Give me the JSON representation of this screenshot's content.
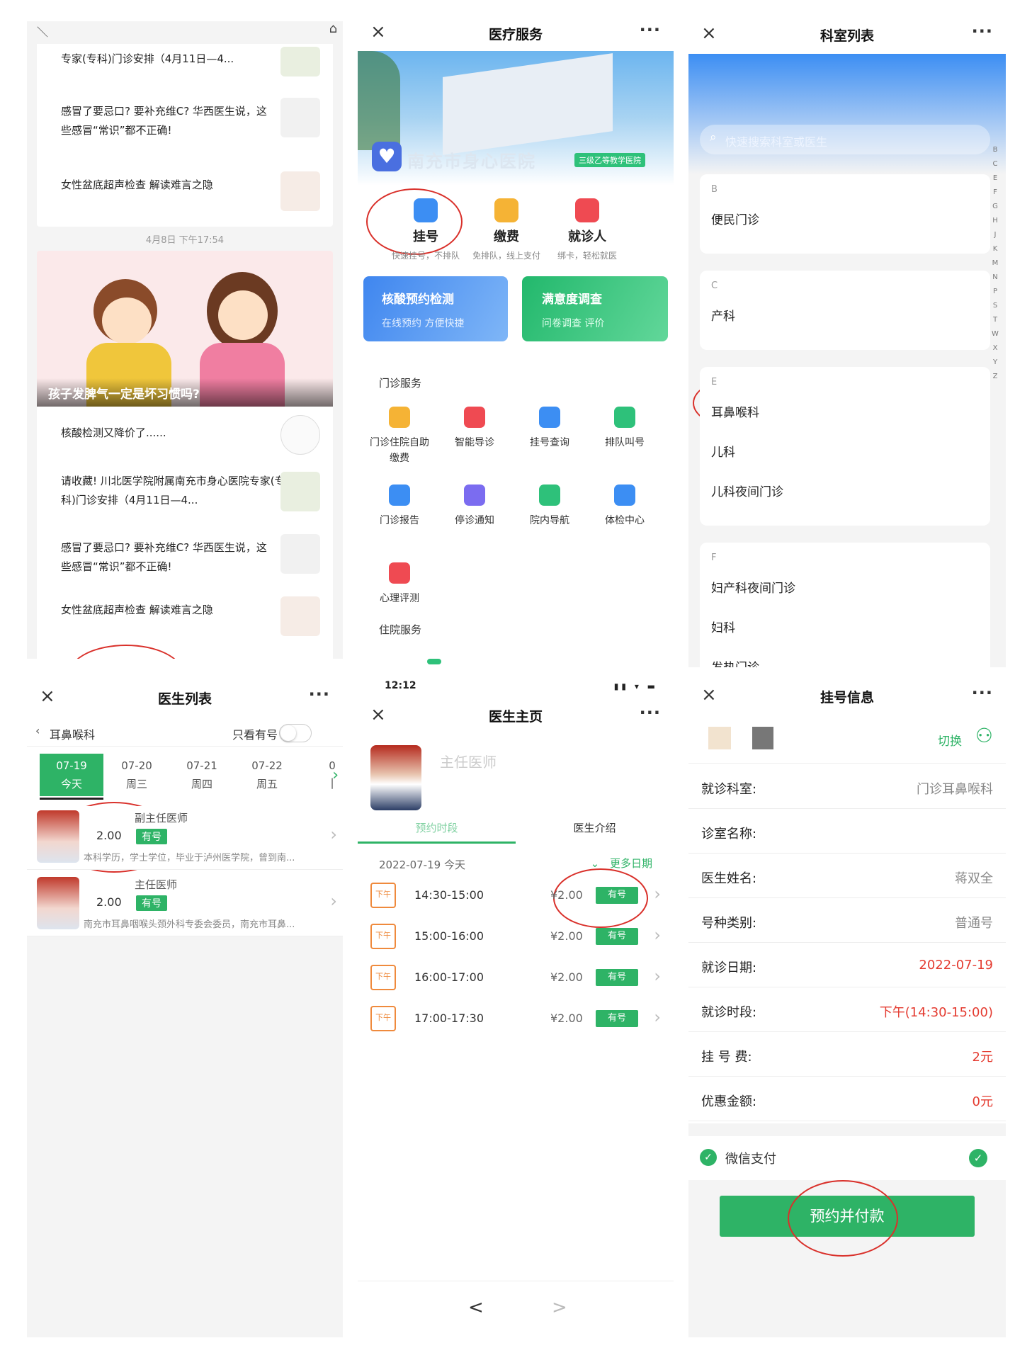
{
  "panel1": {
    "news_top": [
      {
        "title": "专家(专科)门诊安排（4月11日—4..."
      },
      {
        "title": "感冒了要忌口? 要补充维C? 华西医生说，这些感冒“常识”都不正确!"
      },
      {
        "title": "女性盆底超声检查 解读难言之隐"
      }
    ],
    "timestamp": "4月8日 下午17:54",
    "feature_caption": "孩子发脾气一定是坏习惯吗?",
    "news_bottom": [
      {
        "title": "核酸检测又降价了......"
      },
      {
        "title": "请收藏! 川北医学院附属南充市身心医院专家(专科)门诊安排（4月11日—4..."
      },
      {
        "title": "感冒了要忌口? 要补充维C? 华西医生说，这些感冒“常识”都不正确!"
      },
      {
        "title": "女性盆底超声检查 解读难言之隐"
      }
    ]
  },
  "panel2": {
    "title": "医疗服务",
    "close": "×",
    "more": "···",
    "hospital_name": "南充市身心医院",
    "hospital_badge": "三级乙等教学医院",
    "main_actions": [
      {
        "label": "挂号",
        "sub": "快速挂号，不排队",
        "color": "#3c8ef3"
      },
      {
        "label": "缴费",
        "sub": "免排队，线上支付",
        "color": "#f5b335"
      },
      {
        "label": "就诊人",
        "sub": "绑卡，轻松就医",
        "color": "#ef4a52"
      }
    ],
    "banners": [
      {
        "title": "核酸预约检测",
        "sub": "在线预约 方便快捷",
        "color": "#4b8ff0"
      },
      {
        "title": "满意度调查",
        "sub": "问卷调查 评价",
        "color": "#2ec17a"
      }
    ],
    "section_outpatient": "门诊服务",
    "services": [
      {
        "label": "门诊住院自助缴费",
        "color": "#f5b335"
      },
      {
        "label": "智能导诊",
        "color": "#ef4a52"
      },
      {
        "label": "挂号查询",
        "color": "#3c8ef3"
      },
      {
        "label": "排队叫号",
        "color": "#2ec17a"
      },
      {
        "label": "门诊报告",
        "color": "#3c8ef3"
      },
      {
        "label": "停诊通知",
        "color": "#7b6cf0"
      },
      {
        "label": "院内导航",
        "color": "#2ec17a"
      },
      {
        "label": "体检中心",
        "color": "#3c8ef3"
      },
      {
        "label": "心理评测",
        "color": "#ef4a52"
      }
    ],
    "section_inpatient": "住院服务"
  },
  "panel3": {
    "title": "科室列表",
    "close": "×",
    "more": "···",
    "search_placeholder": "快速搜索科室或医生",
    "groups": [
      {
        "letter": "B",
        "items": [
          "便民门诊"
        ]
      },
      {
        "letter": "C",
        "items": [
          "产科"
        ]
      },
      {
        "letter": "E",
        "items": [
          "耳鼻喉科",
          "儿科",
          "儿科夜间门诊"
        ]
      },
      {
        "letter": "F",
        "items": [
          "妇产科夜间门诊",
          "妇科",
          "发热门诊"
        ]
      }
    ],
    "index_letters": [
      "B",
      "C",
      "E",
      "F",
      "G",
      "H",
      "J",
      "K",
      "M",
      "N",
      "P",
      "S",
      "T",
      "W",
      "X",
      "Y",
      "Z"
    ]
  },
  "panel4": {
    "title": "医生列表",
    "close": "×",
    "more": "···",
    "back_label": "耳鼻喉科",
    "only_available": "只看有号",
    "dates": [
      {
        "date": "07-19",
        "day": "今天"
      },
      {
        "date": "07-20",
        "day": "周三"
      },
      {
        "date": "07-21",
        "day": "周四"
      },
      {
        "date": "07-22",
        "day": "周五"
      },
      {
        "date": "0",
        "day": "|"
      }
    ],
    "doctors": [
      {
        "title": "副主任医师",
        "price": "2.00",
        "badge": "有号",
        "desc": "本科学历，学士学位，毕业于泸州医学院，曾到南..."
      },
      {
        "title": "主任医师",
        "price": "2.00",
        "badge": "有号",
        "desc": "南充市耳鼻咽喉头颈外科专委会委员，南充市耳鼻..."
      }
    ]
  },
  "panel5": {
    "status_time": "12:12",
    "title": "医生主页",
    "close": "×",
    "more": "···",
    "doctor_title": "主任医师",
    "tabs": [
      "预约时段",
      "医生介绍"
    ],
    "date_line": "2022-07-19 今天",
    "more_dates": "更多日期",
    "slots": [
      {
        "period": "下午",
        "time": "14:30-15:00",
        "price": "¥2.00",
        "badge": "有号"
      },
      {
        "period": "下午",
        "time": "15:00-16:00",
        "price": "¥2.00",
        "badge": "有号"
      },
      {
        "period": "下午",
        "time": "16:00-17:00",
        "price": "¥2.00",
        "badge": "有号"
      },
      {
        "period": "下午",
        "time": "17:00-17:30",
        "price": "¥2.00",
        "badge": "有号"
      }
    ],
    "nav_back": "<",
    "nav_forward": ">"
  },
  "panel6": {
    "title": "挂号信息",
    "close": "×",
    "more": "···",
    "switch_label": "切换",
    "rows": [
      {
        "key": "就诊科室:",
        "value": "门诊耳鼻喉科",
        "red": false
      },
      {
        "key": "诊室名称:",
        "value": "",
        "red": false
      },
      {
        "key": "医生姓名:",
        "value": "蒋双全",
        "red": false
      },
      {
        "key": "号种类别:",
        "value": "普通号",
        "red": false
      },
      {
        "key": "就诊日期:",
        "value": "2022-07-19",
        "red": true
      },
      {
        "key": "就诊时段:",
        "value": "下午(14:30-15:00)",
        "red": true
      },
      {
        "key": "挂 号 费:",
        "value": "2元",
        "red": true
      },
      {
        "key": "优惠金额:",
        "value": "0元",
        "red": true
      }
    ],
    "payment_method": "微信支付",
    "pay_button": "预约并付款"
  },
  "colors": {
    "green": "#2eb366",
    "red_annotation": "#d9302a",
    "blue_header": "#3c8ef3"
  }
}
